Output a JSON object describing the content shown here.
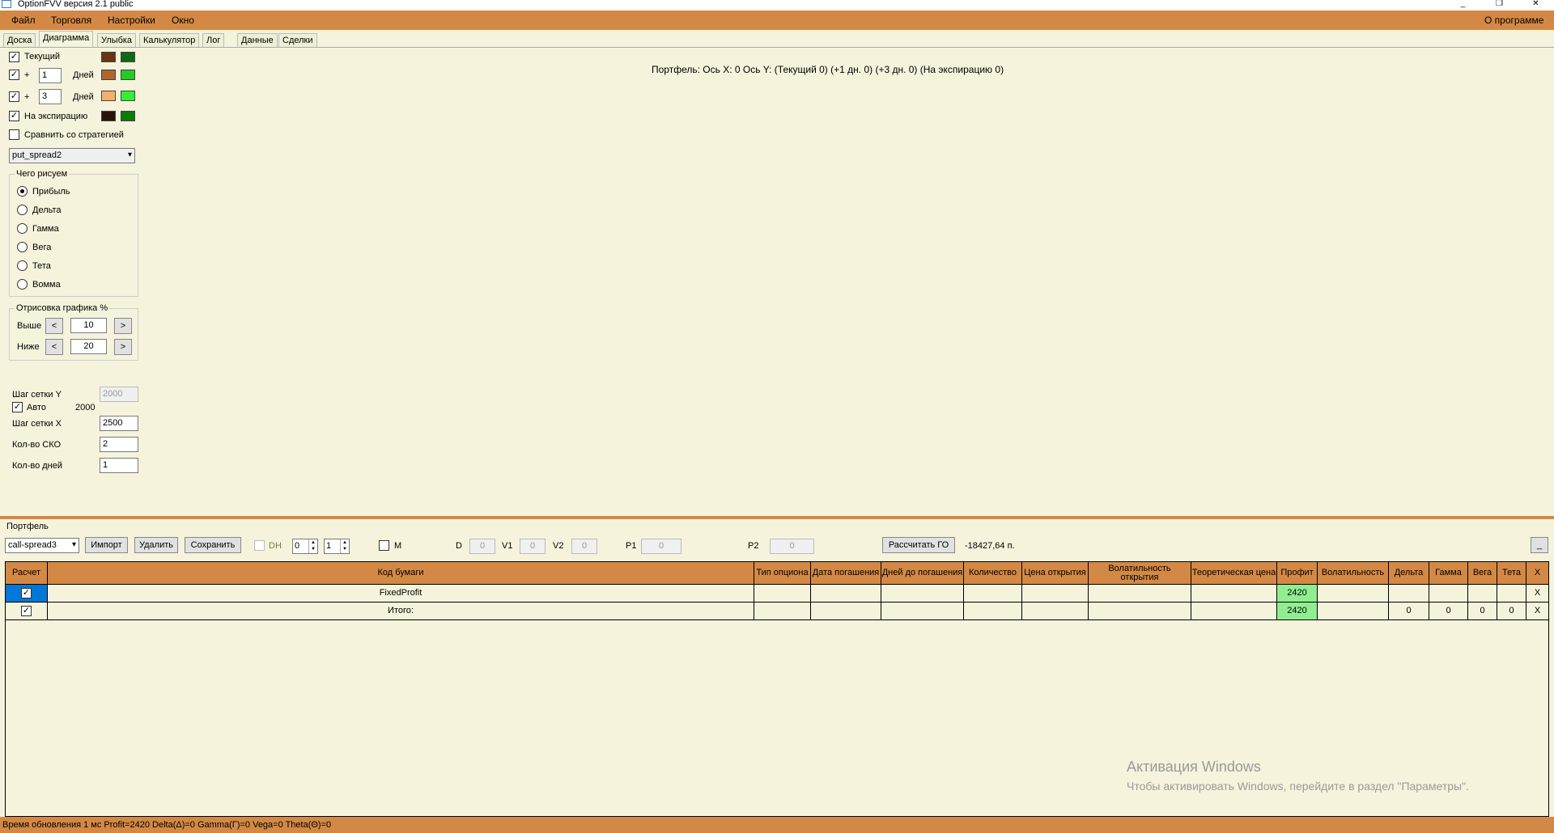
{
  "window": {
    "title": "OptionFVV версия 2.1 public",
    "controls": [
      "_",
      "❐",
      "✕"
    ]
  },
  "menu": {
    "items": [
      "Файл",
      "Торговля",
      "Настройки",
      "Окно"
    ],
    "about": "О программе"
  },
  "tabs": [
    "Доска",
    "Диаграмма",
    "Улыбка",
    "Калькулятор",
    "Лог",
    "Данные",
    "Сделки"
  ],
  "tabs_active": "Диаграмма",
  "curves": {
    "current": {
      "label": "Текущий",
      "checked": true,
      "colors": [
        "#6b3410",
        "#0c6a10"
      ]
    },
    "plus1": {
      "plus": "+",
      "value": "1",
      "unit": "Дней",
      "checked": true,
      "colors": [
        "#b0652c",
        "#22cc22"
      ]
    },
    "plus3": {
      "plus": "+",
      "value": "3",
      "unit": "Дней",
      "checked": true,
      "colors": [
        "#f4b06a",
        "#33ee33"
      ]
    },
    "expiry": {
      "label": "На экспирацию",
      "checked": true,
      "colors": [
        "#2a1608",
        "#0c7a0c"
      ]
    },
    "compare": {
      "label": "Сравнить со стратегией",
      "checked": false
    }
  },
  "strategy_select": "put_spread2",
  "draw_group": {
    "title": "Чего рисуем",
    "options": [
      "Прибыль",
      "Дельта",
      "Гамма",
      "Вега",
      "Тета",
      "Вомма"
    ],
    "selected": "Прибыль"
  },
  "chart_area_group": {
    "title": "Отрисовка графика %",
    "above_label": "Выше",
    "above_value": "10",
    "below_label": "Ниже",
    "below_value": "20",
    "left_arrow": "<",
    "right_arrow": ">"
  },
  "grid_settings": {
    "step_y_label": "Шаг сетки Y",
    "step_y_value": "2000",
    "auto_label": "Авто",
    "auto_checked": true,
    "auto_value": "2000",
    "step_x_label": "Шаг сетки X",
    "step_x_value": "2500",
    "sko_label": "Кол-во СКО",
    "sko_value": "2",
    "days_label": "Кол-во дней",
    "days_value": "1"
  },
  "chart_header": "Портфель: Ось X: 0 Ось Y:  (Текущий 0)  (+1 дн. 0)  (+3 дн. 0)  (На экспирацию 0)",
  "portfolio": {
    "title": "Портфель",
    "select": "call-spread3",
    "import_btn": "Импорт",
    "delete_btn": "Удалить",
    "save_btn": "Сохранить",
    "dh_label": "DH",
    "spin1": "0",
    "spin2": "1",
    "m_label": "M",
    "d_label": "D",
    "d_value": "0",
    "v1_label": "V1",
    "v1_value": "0",
    "v2_label": "V2",
    "v2_value": "0",
    "p1_label": "P1",
    "p1_value": "0",
    "p2_label": "P2",
    "p2_value": "0",
    "calc_btn": "Рассчитать ГО",
    "go_value": "-18427,64 п.",
    "minimize_btn": "_"
  },
  "table": {
    "headers": [
      "Расчет",
      "Код бумаги",
      "Тип опциона",
      "Дата погашения",
      "Дней до погашения",
      "Количество",
      "Цена открытия",
      "Волатильность открытия",
      "Теоретическая цена",
      "Профит",
      "Волатильность",
      "Дельта",
      "Гамма",
      "Вега",
      "Тета",
      "X"
    ],
    "rows": [
      {
        "calc": true,
        "code": "FixedProfit",
        "type": "",
        "date": "",
        "days": "",
        "qty": "",
        "price": "",
        "vol_open": "",
        "theo": "",
        "profit": "2420",
        "vol": "",
        "delta": "",
        "gamma": "",
        "vega": "",
        "theta": "",
        "x": "X"
      },
      {
        "calc": true,
        "code": "Итого:",
        "type": "",
        "date": "",
        "days": "",
        "qty": "",
        "price": "",
        "vol_open": "",
        "theo": "",
        "profit": "2420",
        "vol": "",
        "delta": "0",
        "gamma": "0",
        "vega": "0",
        "theta": "0",
        "x": "X"
      }
    ]
  },
  "watermark": {
    "line1": "Активация Windows",
    "line2": "Чтобы активировать Windows, перейдите в раздел \"Параметры\"."
  },
  "status": "Время обновления 1 мс  Profit=2420 Delta(Δ)=0 Gamma(Γ)=0 Vega=0 Theta(Θ)=0"
}
